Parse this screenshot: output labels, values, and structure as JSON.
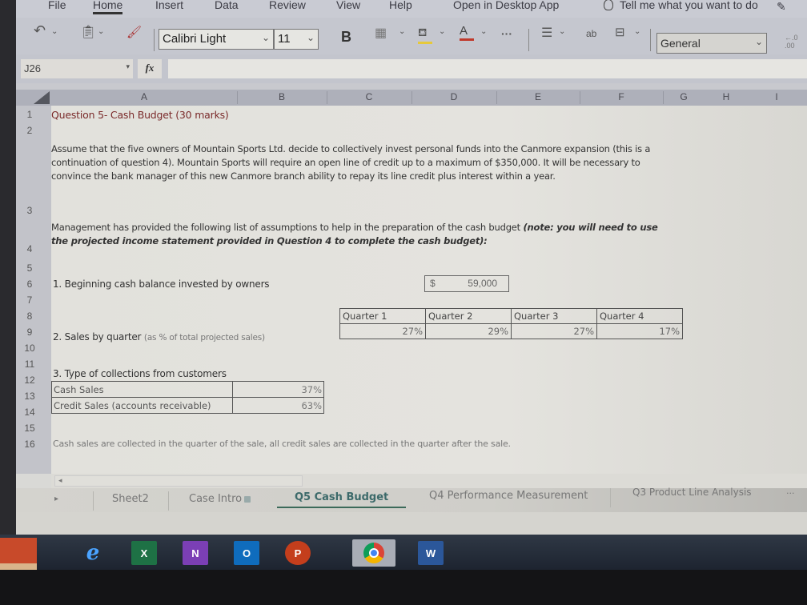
{
  "ribbon": {
    "tabs": [
      "File",
      "Home",
      "Insert",
      "Data",
      "Review",
      "View",
      "Help",
      "Open in Desktop App"
    ],
    "active_tab": "Home",
    "tell_me": "Tell me what you want to do"
  },
  "toolbar": {
    "font_name": "Calibri Light",
    "font_size": "11",
    "bold_label": "B",
    "more_label": "···",
    "wrap_label": "ab",
    "number_format": "General",
    "font_color": "#c0392b",
    "fill_color": "#e6c93a"
  },
  "formula_bar": {
    "name_box": "J26",
    "fx_label": "fx",
    "formula": ""
  },
  "grid": {
    "columns": [
      "A",
      "B",
      "C",
      "D",
      "E",
      "F",
      "G",
      "H",
      "I"
    ],
    "rows": [
      "1",
      "2",
      "3",
      "4",
      "5",
      "6",
      "7",
      "8",
      "9",
      "10",
      "11",
      "12",
      "13",
      "14",
      "15",
      "16"
    ]
  },
  "content": {
    "title": "Question 5- Cash Budget (30 marks)",
    "paragraph1": "Assume that the five owners of Mountain Sports Ltd. decide to collectively invest personal funds into the Canmore expansion (this is a continuation of question 4).  Mountain Sports will require an open line of credit up to a maximum of $350,000.  It will be necessary to convince the bank manager of this new Canmore branch ability to repay its line credit plus interest within a year.",
    "paragraph2_plain": "Management has provided the following list of assumptions to help in the preparation of the cash budget ",
    "paragraph2_emph": "(note: you will need to use the projected income statement provided in Question 4 to complete the cash budget):",
    "item1_label": "1. Beginning cash balance invested by owners",
    "item1_currency": "$",
    "item1_value": "59,000",
    "item2_label": "2. Sales by quarter",
    "item2_note": "(as % of total projected sales)",
    "quarters": [
      {
        "label": "Quarter 1",
        "pct": "27%"
      },
      {
        "label": "Quarter 2",
        "pct": "29%"
      },
      {
        "label": "Quarter 3",
        "pct": "27%"
      },
      {
        "label": "Quarter 4",
        "pct": "17%"
      }
    ],
    "item3_label": "3. Type of collections from customers",
    "collections": [
      {
        "label": "Cash Sales",
        "pct": "37%"
      },
      {
        "label": "Credit Sales (accounts receivable)",
        "pct": "63%"
      }
    ],
    "note": "Cash sales are collected in the quarter of the sale, all credit sales are collected in the quarter after the sale."
  },
  "sheet_tabs": {
    "tabs": [
      "Sheet2",
      "Case Intro",
      "Q5 Cash Budget",
      "Q4 Performance Measurement",
      "Q3 Product Line Analysis"
    ],
    "active": "Q5 Cash Budget",
    "more": "···"
  },
  "taskbar": {
    "apps": [
      {
        "name": "Internet Explorer",
        "letter": "e",
        "color": "#2d7bd0"
      },
      {
        "name": "Excel",
        "letter": "X",
        "color": "#1e7145"
      },
      {
        "name": "OneNote",
        "letter": "N",
        "color": "#7b3fb5"
      },
      {
        "name": "Outlook",
        "letter": "O",
        "color": "#0f6cbd"
      },
      {
        "name": "PowerPoint",
        "letter": "P",
        "color": "#c43e1c"
      },
      {
        "name": "Chrome",
        "letter": "",
        "color": "#4285f4"
      },
      {
        "name": "Word",
        "letter": "W",
        "color": "#2b579a"
      }
    ]
  }
}
